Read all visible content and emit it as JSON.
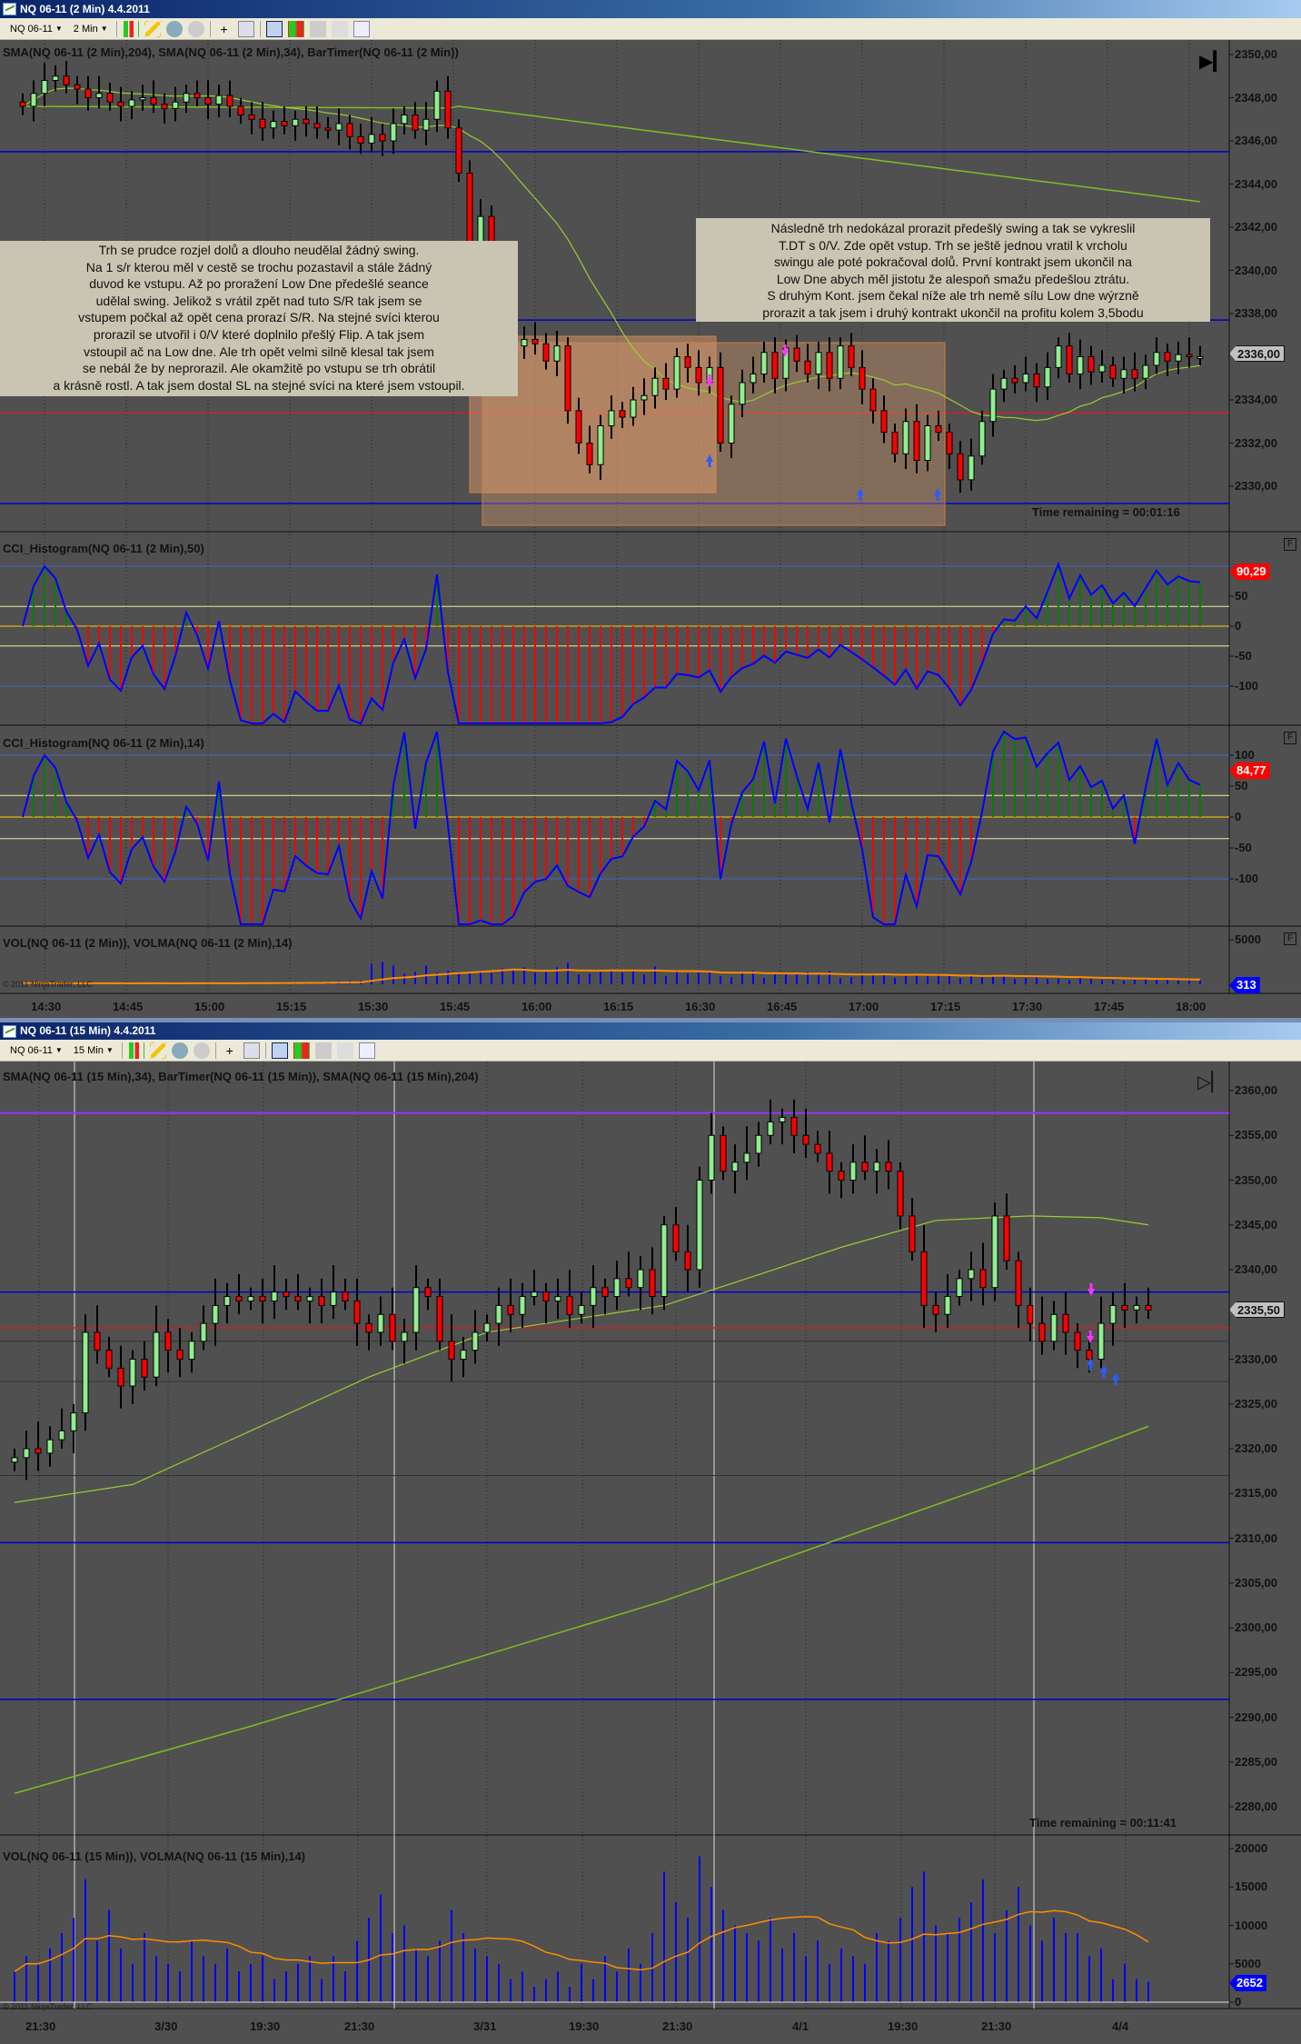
{
  "window_top": {
    "title": "NQ 06-11 (2 Min)  4.4.2011",
    "toolbar": {
      "instrument": "NQ 06-11",
      "interval": "2 Min"
    },
    "price_panel_label": "SMA(NQ 06-11 (2 Min),204), SMA(NQ 06-11 (2 Min),34), BarTimer(NQ 06-11 (2 Min))",
    "cci1_label": "CCI_Histogram(NQ 06-11 (2 Min),50)",
    "cci2_label": "CCI_Histogram(NQ 06-11 (2 Min),14)",
    "vol_label": "VOL(NQ 06-11 (2 Min)), VOLMA(NQ 06-11 (2 Min),14)",
    "copyright": "© 2011 NinjaTrader, LLC",
    "time_remaining": "Time remaining = 00:01:16",
    "price_ticks": [
      "2350,00",
      "2348,00",
      "2346,00",
      "2344,00",
      "2342,00",
      "2340,00",
      "2338,00",
      "2334,00",
      "2332,00",
      "2330,00"
    ],
    "price_tag": "2336,00",
    "cci1_ticks": [
      "50",
      "0",
      "-50",
      "-100"
    ],
    "cci1_tag": "90,29",
    "cci2_ticks": [
      "100",
      "50",
      "0",
      "-50",
      "-100"
    ],
    "cci2_tag": "84,77",
    "vol_ticks": [
      "5000"
    ],
    "vol_tag": "313",
    "panel_button": "F",
    "time_labels": [
      "14:30",
      "14:45",
      "15:00",
      "15:15",
      "15:30",
      "15:45",
      "16:00",
      "16:15",
      "16:30",
      "16:45",
      "17:00",
      "17:15",
      "17:30",
      "17:45",
      "18:00"
    ],
    "notes": [
      [
        "Trh se prudce rozjel dolů a dlouho neudělal žádný swing.",
        "Na 1 s/r kterou měl v cestě se trochu pozastavil a stále žádný",
        "duvod ke vstupu. Až po proražení Low Dne předešlé seance",
        "udělal swing. Jelikož s vrátil zpět nad tuto S/R tak jsem se",
        "vstupem počkal až opět cena prorazí S/R. Na stejné svíci kterou",
        "prorazil se utvořil i 0/V které doplnilo přešlý Flip. A tak jsem",
        "vstoupil ač na Low dne. Ale trh opět velmi silně klesal tak jsem",
        "se nebál že by neprorazil. Ale okamžitě po vstupu se trh obrátil",
        "a krásně rostl. A tak jsem dostal SL na stejné svíci na které jsem vstoupil."
      ],
      [
        "Následně trh nedokázal prorazit předešlý swing a tak se vykreslil",
        "T.DT s 0/V. Zde opět vstup. Trh se ještě jednou vratil k vrcholu",
        "swingu ale poté pokračoval dolů. První kontrakt jsem ukončil na",
        "Low Dne abych měl jistotu že alespoň smažu předešlou ztrátu.",
        "S druhým Kont. jsem čekal níže ale trh nemě sílu Low dne wýrzně",
        "prorazit a tak jsem i druhý kontrakt ukončil na profitu kolem 3,5bodu"
      ]
    ]
  },
  "window_bottom": {
    "title": "NQ 06-11 (15 Min)  4.4.2011",
    "toolbar": {
      "instrument": "NQ 06-11",
      "interval": "15 Min"
    },
    "price_panel_label": "SMA(NQ 06-11 (15 Min),34), BarTimer(NQ 06-11 (15 Min)), SMA(NQ 06-11 (15 Min),204)",
    "vol_label": "VOL(NQ 06-11 (15 Min)), VOLMA(NQ 06-11 (15 Min),14)",
    "copyright": "© 2011 NinjaTrader, LLC",
    "time_remaining": "Time remaining = 00:11:41",
    "price_ticks": [
      "2360,00",
      "2355,00",
      "2350,00",
      "2345,00",
      "2340,00",
      "2330,00",
      "2325,00",
      "2320,00",
      "2315,00",
      "2310,00",
      "2305,00",
      "2300,00",
      "2295,00",
      "2290,00",
      "2285,00",
      "2280,00"
    ],
    "price_tag": "2335,50",
    "vol_ticks": [
      "20000",
      "15000",
      "10000",
      "5000",
      "0"
    ],
    "vol_tag": "2652",
    "time_labels": [
      "21:30",
      "3/30",
      "19:30",
      "21:30",
      "3/31",
      "19:30",
      "21:30",
      "4/1",
      "19:30",
      "21:30",
      "4/4"
    ]
  },
  "colors": {
    "up": "#90ee90",
    "down": "#ff0000",
    "sma_fast": "#9acd32",
    "sma_slow": "#7fbf1f",
    "volma": "#ff8c00",
    "vol": "#0000ff",
    "cci_line": "#0000ff",
    "cci_pos": "#008000",
    "cci_neg": "#ff0000",
    "support_blue": "#0000cc",
    "level_red": "#cc2222",
    "level_purple": "#9933ff",
    "box": "#d08040"
  },
  "chart_data": [
    {
      "type": "candlestick",
      "title": "NQ 06-11 (2 Min)",
      "start_time": "14:26",
      "bar_minutes": 2,
      "ylim": [
        2328.5,
        2350.5
      ],
      "closes": [
        2347.6,
        2348.2,
        2348.8,
        2349,
        2348.6,
        2348.4,
        2348,
        2348.2,
        2347.8,
        2347.6,
        2347.9,
        2348,
        2347.7,
        2347.5,
        2347.8,
        2348.2,
        2348,
        2347.7,
        2348.1,
        2347.6,
        2347.2,
        2347,
        2346.6,
        2346.9,
        2346.7,
        2347,
        2346.8,
        2346.6,
        2346.5,
        2346.8,
        2346.2,
        2345.9,
        2346.3,
        2346,
        2346.8,
        2347.2,
        2346.5,
        2347,
        2348.3,
        2346.6,
        2344.5,
        2341.2,
        2342.5,
        2340,
        2338.2,
        2336.5,
        2336.8,
        2336.6,
        2335.8,
        2336.5,
        2333.5,
        2332,
        2331,
        2332.8,
        2333.5,
        2333.2,
        2334,
        2334.2,
        2335,
        2334.5,
        2336,
        2335.5,
        2334.8,
        2335.5,
        2332,
        2333.8,
        2334.8,
        2335.2,
        2336.2,
        2335,
        2336.4,
        2335.8,
        2335.2,
        2336.2,
        2335,
        2336.5,
        2335.5,
        2334.5,
        2333.5,
        2332.5,
        2331.5,
        2333,
        2331.2,
        2332.8,
        2332.5,
        2331.5,
        2330.3,
        2331.4,
        2333,
        2334.5,
        2335,
        2334.8,
        2335.2,
        2334.6,
        2335.5,
        2336.5,
        2335.2,
        2336,
        2335.3,
        2335.6,
        2335,
        2335.4,
        2335,
        2335.6,
        2336.2,
        2335.8,
        2336.1,
        2336,
        2336
      ],
      "volumes": [
        150,
        120,
        100,
        110,
        90,
        100,
        120,
        100,
        90,
        110,
        100,
        120,
        130,
        110,
        100,
        140,
        120,
        110,
        130,
        150,
        140,
        160,
        150,
        170,
        200,
        180,
        220,
        250,
        300,
        350,
        380,
        420,
        2300,
        2500,
        2100,
        1200,
        1400,
        2100,
        1300,
        1500,
        1400,
        1200,
        1500,
        1300,
        1800,
        1600,
        1900,
        1300,
        1500,
        1900,
        2400,
        1100,
        1200,
        1400,
        1600,
        1300,
        1500,
        1100,
        2000,
        900,
        1600,
        1200,
        1300,
        1400,
        900,
        800,
        1300,
        1500,
        700,
        1100,
        1200,
        1300,
        1400,
        1000,
        1500,
        700,
        800,
        1100,
        1000,
        1200,
        700,
        1100,
        1000,
        900,
        1200,
        900,
        700,
        1000,
        800,
        900,
        1100,
        600,
        700,
        900,
        600,
        650,
        500,
        700,
        600,
        500,
        450,
        400,
        500,
        700,
        550,
        600,
        450,
        500,
        450
      ]
    },
    {
      "type": "candlestick",
      "title": "NQ 06-11 (15 Min)",
      "bar_minutes": 15,
      "ylim": [
        2277,
        2362
      ],
      "closes": [
        2319,
        2320,
        2319.5,
        2321,
        2322,
        2324,
        2333,
        2331,
        2329,
        2327,
        2330,
        2328,
        2333,
        2331,
        2330,
        2332,
        2334,
        2336,
        2337,
        2336.5,
        2337,
        2336.5,
        2337.5,
        2337,
        2336.5,
        2337,
        2336,
        2337.5,
        2336.5,
        2334,
        2333,
        2335,
        2332,
        2333,
        2338,
        2337,
        2332,
        2330,
        2331,
        2333,
        2334,
        2336,
        2335,
        2337,
        2337.5,
        2336.5,
        2337,
        2335,
        2336,
        2338,
        2337,
        2339,
        2338,
        2340,
        2337,
        2345,
        2342,
        2340,
        2350,
        2355,
        2351,
        2352,
        2353,
        2355,
        2356.5,
        2357,
        2355,
        2354,
        2353,
        2351,
        2350,
        2352,
        2351,
        2352,
        2351,
        2346,
        2342,
        2336,
        2335,
        2337,
        2339,
        2340,
        2338,
        2346,
        2341,
        2336,
        2334,
        2332,
        2335,
        2333,
        2331,
        2330,
        2334,
        2336,
        2335.5,
        2336,
        2335.5
      ],
      "volumes": [
        4000,
        6000,
        5000,
        7000,
        9000,
        11000,
        16000,
        8000,
        12000,
        7000,
        5000,
        9000,
        6000,
        5000,
        4000,
        8000,
        6000,
        5000,
        7000,
        4000,
        5000,
        6000,
        3000,
        4000,
        5000,
        6000,
        3000,
        6000,
        4000,
        8000,
        11000,
        14000,
        9000,
        10000,
        7000,
        6000,
        8000,
        12000,
        9000,
        7000,
        6000,
        5000,
        3000,
        4000,
        2000,
        3000,
        4000,
        2000,
        5000,
        3000,
        6000,
        4000,
        7000,
        5000,
        9000,
        17000,
        13000,
        11000,
        19000,
        15000,
        12000,
        10000,
        9000,
        8000,
        11000,
        7000,
        9000,
        6000,
        8000,
        5000,
        7000,
        6000,
        5000,
        9000,
        8000,
        11000,
        15000,
        17000,
        10000,
        9000,
        11000,
        13000,
        16000,
        9000,
        12000,
        15000,
        10000,
        8000,
        11000,
        9000,
        9000,
        6000,
        7000,
        3000,
        5000,
        3000,
        2652
      ],
      "sma34": [
        [
          0,
          2314
        ],
        [
          10,
          2316
        ],
        [
          20,
          2322
        ],
        [
          30,
          2328
        ],
        [
          40,
          2333
        ],
        [
          50,
          2335
        ],
        [
          55,
          2336
        ],
        [
          62,
          2339
        ],
        [
          70,
          2342.5
        ],
        [
          78,
          2345.5
        ],
        [
          86,
          2346
        ],
        [
          92,
          2345.8
        ],
        [
          96,
          2345
        ]
      ],
      "sma204": [
        [
          0,
          2281.5
        ],
        [
          20,
          2289
        ],
        [
          40,
          2297
        ],
        [
          55,
          2303
        ],
        [
          70,
          2310
        ],
        [
          85,
          2317
        ],
        [
          96,
          2322.5
        ]
      ],
      "lines": {
        "purple": 2357.5,
        "blue": [
          2337.5,
          2309.5,
          2292
        ],
        "red": 2333.5
      }
    }
  ]
}
